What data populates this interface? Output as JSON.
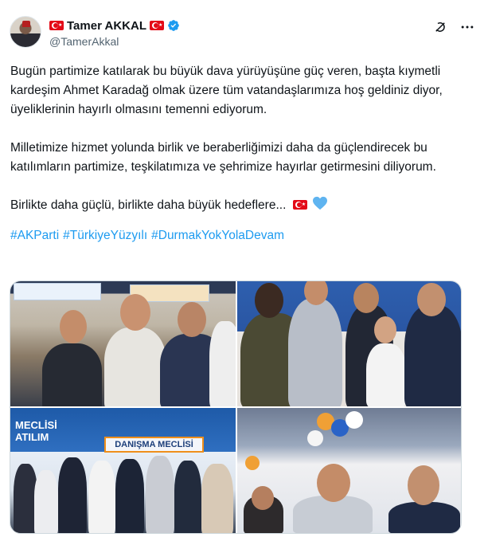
{
  "user": {
    "display_name": "Tamer AKKAL",
    "handle": "@TamerAkkal"
  },
  "tweet": {
    "paragraphs": [
      "Bugün partimize katılarak bu büyük dava yürüyüşüne güç veren, başta kıymetli kardeşim Ahmet Karadağ olmak üzere tüm vatandaşlarımıza hoş geldiniz diyor, üyeliklerinin hayırlı olmasını temenni ediyorum.",
      "Milletimize hizmet yolunda birlik ve beraberliğimizi daha da güçlendirecek bu katılımların partimize, teşkilatımıza ve şehrimize hayırlar getirmesini diliyorum.",
      "Birlikte daha güçlü, birlikte daha büyük hedeflere..."
    ],
    "hashtags": [
      "#AKParti",
      "#TürkiyeYüzyılı",
      "#DurmakYokYolaDevam"
    ]
  },
  "media": {
    "photo3_text": [
      "MECLİSİ",
      "ATILIM"
    ],
    "photo3_sign": "DANIŞMA MECLİSİ"
  },
  "icons": {
    "header": [
      "turkey-flag-icon",
      "verified-badge-icon",
      "grok-icon",
      "more-icon"
    ],
    "inline": [
      "turkey-flag-icon",
      "blue-heart-icon"
    ]
  },
  "colors": {
    "link": "#1d9bf0",
    "verified": "#1d9bf0",
    "flag_red": "#e30a17",
    "text": "#0f1419",
    "secondary": "#536471"
  }
}
